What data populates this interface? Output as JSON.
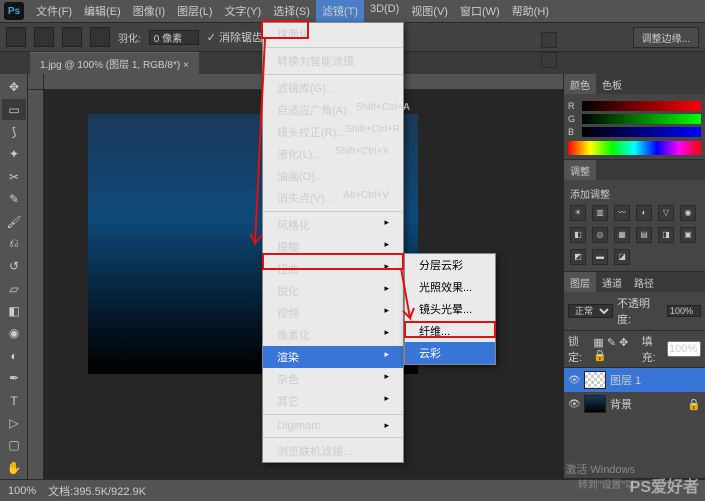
{
  "menubar": [
    "文件(F)",
    "编辑(E)",
    "图像(I)",
    "图层(L)",
    "文字(Y)",
    "选择(S)",
    "滤镜(T)",
    "3D(D)",
    "视图(V)",
    "窗口(W)",
    "帮助(H)"
  ],
  "active_menu_index": 6,
  "options_bar": {
    "feather_label": "羽化:",
    "feather_value": "0 像素",
    "antialias": "消除锯齿",
    "adjust_edge": "调整边缘..."
  },
  "doc_tab": "1.jpg @ 100% (图层 1, RGB/8*) ×",
  "dropdown": [
    {
      "t": "球面化",
      "k": ""
    },
    {
      "sep": true
    },
    {
      "t": "转换为智能滤镜",
      "k": ""
    },
    {
      "sep": true
    },
    {
      "t": "滤镜库(G)...",
      "k": ""
    },
    {
      "t": "自适应广角(A)...",
      "k": "Shift+Ctrl+A"
    },
    {
      "t": "镜头校正(R)...",
      "k": "Shift+Ctrl+R"
    },
    {
      "t": "液化(L)...",
      "k": "Shift+Ctrl+X"
    },
    {
      "t": "油画(O)...",
      "k": ""
    },
    {
      "t": "消失点(V)...",
      "k": "Alt+Ctrl+V"
    },
    {
      "sep": true
    },
    {
      "t": "风格化",
      "sub": true
    },
    {
      "t": "模糊",
      "sub": true
    },
    {
      "t": "扭曲",
      "sub": true
    },
    {
      "t": "锐化",
      "sub": true
    },
    {
      "t": "视频",
      "sub": true
    },
    {
      "t": "像素化",
      "sub": true
    },
    {
      "t": "渲染",
      "sub": true,
      "hl": true
    },
    {
      "t": "杂色",
      "sub": true
    },
    {
      "t": "其它",
      "sub": true
    },
    {
      "sep": true
    },
    {
      "t": "Digimarc",
      "sub": true
    },
    {
      "sep": true
    },
    {
      "t": "浏览联机滤镜...",
      "k": ""
    }
  ],
  "submenu": [
    {
      "t": "分层云彩"
    },
    {
      "t": "光照效果..."
    },
    {
      "t": "镜头光晕..."
    },
    {
      "t": "纤维..."
    },
    {
      "t": "云彩",
      "hl": true
    }
  ],
  "color_panel": {
    "tabs": [
      "颜色",
      "色板"
    ],
    "r": "R",
    "g": "G",
    "b": "B"
  },
  "adjustments_panel": {
    "tabs": [
      "调整"
    ],
    "hint": "添加调整"
  },
  "layers_panel": {
    "tabs": [
      "图层",
      "通道",
      "路径"
    ],
    "blend": "正常",
    "opacity_label": "不透明度:",
    "opacity": "100%",
    "lock_label": "锁定:",
    "fill_label": "填充:",
    "fill": "100%",
    "layers": [
      {
        "name": "图层 1"
      },
      {
        "name": "背景"
      }
    ]
  },
  "status": {
    "zoom": "100%",
    "docinfo": "文档:395.5K/922.9K"
  },
  "watermark": "PS爱好者",
  "wm2": "激活 Windows",
  "wm3": "转到\"设置\"以"
}
